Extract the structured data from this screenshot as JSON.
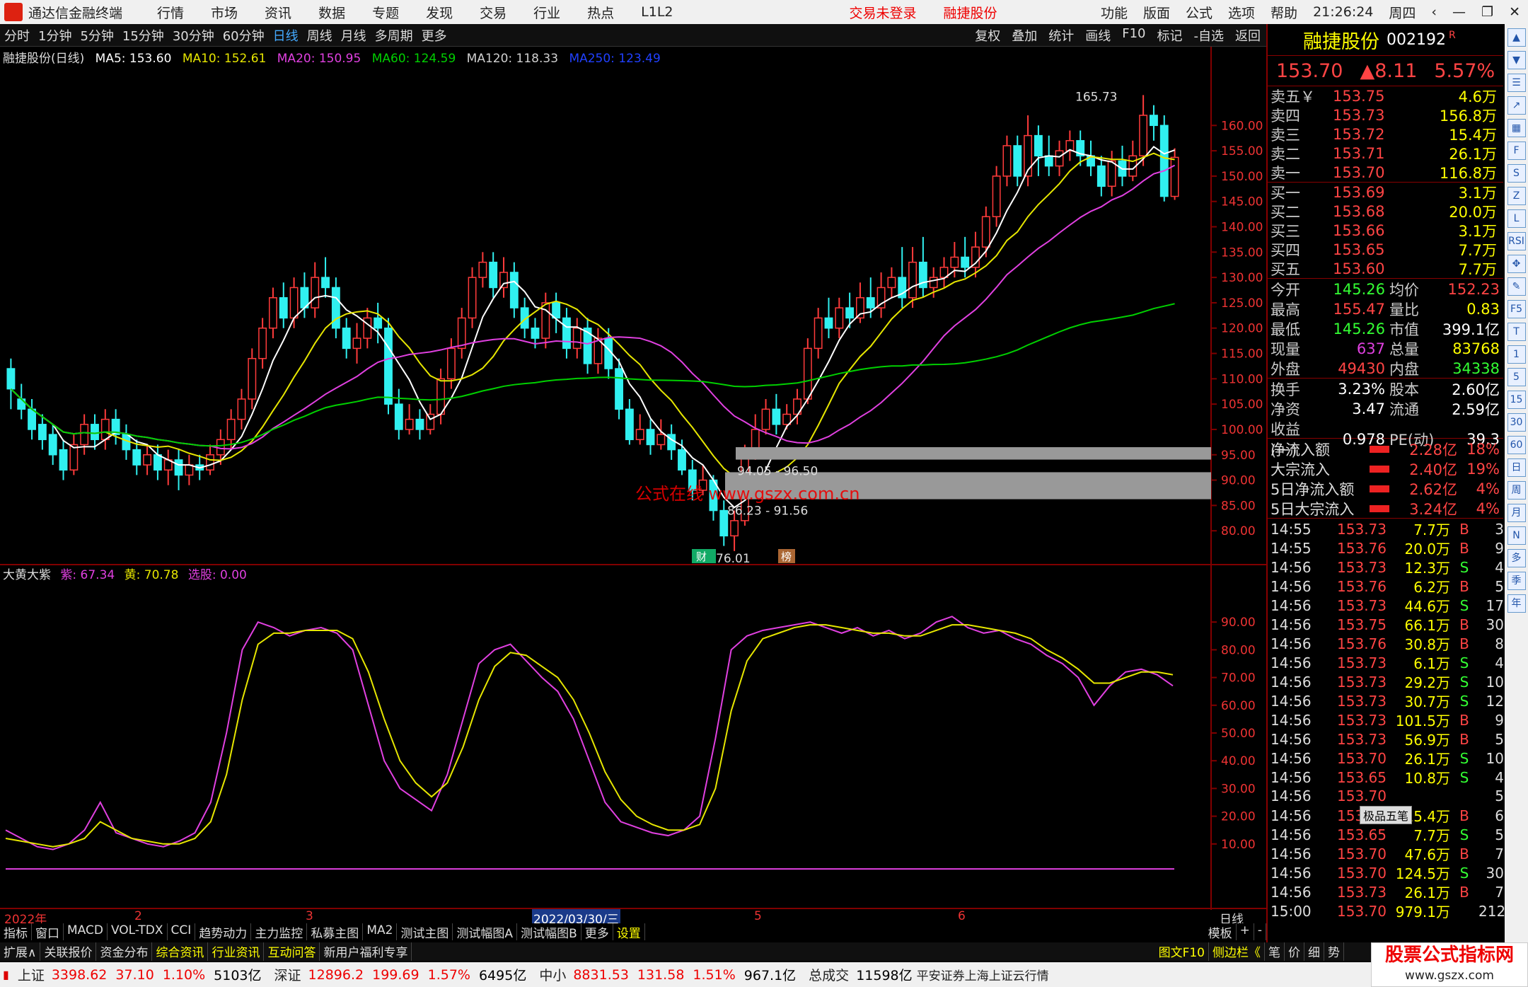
{
  "app": {
    "title": "通达信金融终端",
    "menu": [
      "行情",
      "市场",
      "资讯",
      "数据",
      "专题",
      "发现",
      "交易",
      "行业",
      "热点",
      "L1L2"
    ],
    "login_status": "交易未登录",
    "stock_title": "融捷股份",
    "right_menu": [
      "功能",
      "版面",
      "公式",
      "选项",
      "帮助"
    ],
    "time": "21:26:24",
    "weekday": "周四"
  },
  "periods": [
    "分时",
    "1分钟",
    "5分钟",
    "15分钟",
    "30分钟",
    "60分钟",
    "日线",
    "周线",
    "月线",
    "多周期",
    "更多"
  ],
  "active_period": "日线",
  "toolbar_right": [
    "复权",
    "叠加",
    "统计",
    "画线",
    "F10",
    "标记",
    "-自选",
    "返回"
  ],
  "legend": {
    "name": "融捷股份(日线)",
    "ma5": "MA5: 153.60",
    "ma10": "MA10: 152.61",
    "ma20": "MA20: 150.95",
    "ma60": "MA60: 124.59",
    "ma120": "MA120: 118.33",
    "ma250": "MA250: 123.49"
  },
  "colors": {
    "up": "#ff3b3b",
    "down": "#30f0f0",
    "ma5": "#ffffff",
    "ma10": "#e6e600",
    "ma20": "#e040e0",
    "ma60": "#00d000",
    "ma120": "#d0d0d0",
    "ma250": "#2040ff",
    "purple": "#e040e0",
    "yellow": "#e6e600",
    "grid": "#800000"
  },
  "indicator_legend": {
    "name": "大黄大紫",
    "purple": "紫: 67.34",
    "yellow": "黄: 70.78",
    "sel": "选股: 0.00"
  },
  "annotations": {
    "high": "165.73",
    "low": "76.01",
    "gap1": "94.05 - 96.50",
    "gap2": "86.23 - 91.56",
    "watermark": "公式在线 www.gszx.com.cn",
    "tag1": "财",
    "tag2": "榜"
  },
  "price_axis": [
    "160.00",
    "155.00",
    "150.00",
    "145.00",
    "140.00",
    "135.00",
    "130.00",
    "125.00",
    "120.00",
    "115.00",
    "110.00",
    "105.00",
    "100.00",
    "95.00",
    "90.00",
    "85.00",
    "80.00"
  ],
  "ind_axis": [
    "90.00",
    "80.00",
    "70.00",
    "60.00",
    "50.00",
    "40.00",
    "30.00",
    "20.00",
    "10.00"
  ],
  "dates": [
    {
      "t": "2022年"
    },
    {
      "t": "2"
    },
    {
      "t": "3"
    },
    {
      "t": "2022/03/30/三"
    },
    {
      "t": "5"
    },
    {
      "t": "6"
    },
    {
      "t": "日线"
    }
  ],
  "quote": {
    "name": "融捷股份",
    "code": "002192",
    "flag": "R",
    "price": "153.70",
    "change": "▲8.11",
    "pct": "5.57%",
    "asks": [
      {
        "l": "卖五￥",
        "p": "153.75",
        "v": "4.6万"
      },
      {
        "l": "卖四",
        "p": "153.73",
        "v": "156.8万"
      },
      {
        "l": "卖三",
        "p": "153.72",
        "v": "15.4万"
      },
      {
        "l": "卖二",
        "p": "153.71",
        "v": "26.1万"
      },
      {
        "l": "卖一",
        "p": "153.70",
        "v": "116.8万"
      }
    ],
    "bids": [
      {
        "l": "买一",
        "p": "153.69",
        "v": "3.1万"
      },
      {
        "l": "买二",
        "p": "153.68",
        "v": "20.0万"
      },
      {
        "l": "买三",
        "p": "153.66",
        "v": "3.1万"
      },
      {
        "l": "买四",
        "p": "153.65",
        "v": "7.7万"
      },
      {
        "l": "买五",
        "p": "153.60",
        "v": "7.7万"
      }
    ],
    "stats": [
      [
        "今开",
        "145.26",
        "均价",
        "152.23"
      ],
      [
        "最高",
        "155.47",
        "量比",
        "0.83"
      ],
      [
        "最低",
        "145.26",
        "市值",
        "399.1亿"
      ],
      [
        "现量",
        "637",
        "总量",
        "83768"
      ],
      [
        "外盘",
        "49430",
        "内盘",
        "34338"
      ]
    ],
    "stats2": [
      [
        "换手",
        "3.23%",
        "股本",
        "2.60亿"
      ],
      [
        "净资",
        "3.47",
        "流通",
        "2.59亿"
      ],
      [
        "收益(一)",
        "0.978",
        "PE(动)",
        "39.3"
      ]
    ],
    "flows": [
      [
        "净流入额",
        "2.28亿",
        "18%"
      ],
      [
        "大宗流入",
        "2.40亿",
        "19%"
      ],
      [
        "5日净流入额",
        "2.62亿",
        "4%"
      ],
      [
        "5日大宗流入",
        "3.24亿",
        "4%"
      ]
    ],
    "ticks": [
      [
        "14:55",
        "153.73",
        "7.7万",
        "B",
        "3"
      ],
      [
        "14:55",
        "153.76",
        "20.0万",
        "B",
        "9"
      ],
      [
        "14:56",
        "153.73",
        "12.3万",
        "S",
        "4"
      ],
      [
        "14:56",
        "153.76",
        "6.2万",
        "B",
        "5"
      ],
      [
        "14:56",
        "153.73",
        "44.6万",
        "S",
        "17"
      ],
      [
        "14:56",
        "153.75",
        "66.1万",
        "B",
        "30"
      ],
      [
        "14:56",
        "153.76",
        "30.8万",
        "B",
        "8"
      ],
      [
        "14:56",
        "153.73",
        "6.1万",
        "S",
        "4"
      ],
      [
        "14:56",
        "153.73",
        "29.2万",
        "S",
        "10"
      ],
      [
        "14:56",
        "153.73",
        "30.7万",
        "S",
        "12"
      ],
      [
        "14:56",
        "153.73",
        "101.5万",
        "B",
        "9"
      ],
      [
        "14:56",
        "153.73",
        "56.9万",
        "B",
        "5"
      ],
      [
        "14:56",
        "153.70",
        "26.1万",
        "S",
        "10"
      ],
      [
        "14:56",
        "153.65",
        "10.8万",
        "S",
        "4"
      ],
      [
        "14:56",
        "153.70",
        "",
        "",
        "5"
      ],
      [
        "14:56",
        "153.70",
        "15.4万",
        "B",
        "6"
      ],
      [
        "14:56",
        "153.65",
        "7.7万",
        "S",
        "5"
      ],
      [
        "14:56",
        "153.70",
        "47.6万",
        "B",
        "7"
      ],
      [
        "14:56",
        "153.70",
        "124.5万",
        "S",
        "30"
      ],
      [
        "14:56",
        "153.73",
        "26.1万",
        "B",
        "7"
      ],
      [
        "15:00",
        "153.70",
        "979.1万",
        "",
        "212"
      ]
    ],
    "ime": "极品五笔"
  },
  "side_icons": [
    "up-icon",
    "down-icon",
    "list-icon",
    "chart-icon",
    "grid-icon",
    "F",
    "S",
    "Z",
    "L",
    "RSI",
    "move-icon",
    "pen-icon",
    "F5",
    "T",
    "1",
    "5",
    "15",
    "30",
    "60",
    "日",
    "周",
    "月",
    "N",
    "多",
    "季",
    "年"
  ],
  "bottom_tabs": [
    "指标",
    "窗口",
    "MACD",
    "VOL-TDX",
    "CCI",
    "趋势动力",
    "主力监控",
    "私募主图",
    "MA2",
    "测试主图",
    "测试幅图A",
    "测试幅图B",
    "更多",
    "设置"
  ],
  "bottom_tabs_right": [
    "模板",
    "+",
    "-"
  ],
  "bottom_tabs2": [
    "扩展∧",
    "关联报价",
    "资金分布",
    "综合资讯",
    "行业资讯",
    "互动问答",
    "新用户福利专享"
  ],
  "bottom_tabs2_right": [
    "图文F10",
    "侧边栏《",
    "笔",
    "价",
    "细",
    "势"
  ],
  "status": {
    "sh_label": "上证",
    "sh_val": "3398.62",
    "sh_chg": "37.10",
    "sh_pct": "1.10%",
    "sh_amt": "5103亿",
    "sz_label": "深证",
    "sz_val": "12896.2",
    "sz_chg": "199.69",
    "sz_pct": "1.57%",
    "sz_amt": "6495亿",
    "zx_label": "中小",
    "zx_val": "8831.53",
    "zx_chg": "131.58",
    "zx_pct": "1.51%",
    "zx_amt": "967.1亿",
    "total_label": "总成交",
    "total_val": "11598亿",
    "src": "平安证券上海上证云行情",
    "brand": "股票公式指标网",
    "brand_url": "www.gszx.com"
  },
  "chart_data": [
    {
      "type": "candlestick",
      "title": "融捷股份(日线)",
      "ylim": [
        75,
        168
      ],
      "candles": [
        [
          112,
          108,
          114,
          104
        ],
        [
          106,
          104,
          109,
          102
        ],
        [
          104,
          100,
          106,
          98
        ],
        [
          101,
          98,
          103,
          96
        ],
        [
          99,
          95,
          101,
          93
        ],
        [
          96,
          92,
          98,
          90
        ],
        [
          92,
          97,
          99,
          91
        ],
        [
          97,
          101,
          103,
          95
        ],
        [
          101,
          98,
          103,
          96
        ],
        [
          98,
          102,
          104,
          96
        ],
        [
          102,
          99,
          104,
          97
        ],
        [
          99,
          96,
          101,
          94
        ],
        [
          96,
          93,
          98,
          91
        ],
        [
          93,
          95,
          97,
          91
        ],
        [
          95,
          92,
          97,
          90
        ],
        [
          92,
          94,
          96,
          89
        ],
        [
          94,
          91,
          96,
          88
        ],
        [
          91,
          93,
          95,
          89
        ],
        [
          93,
          92,
          95,
          90
        ],
        [
          92,
          95,
          97,
          91
        ],
        [
          95,
          98,
          100,
          93
        ],
        [
          98,
          102,
          104,
          96
        ],
        [
          102,
          106,
          108,
          100
        ],
        [
          106,
          114,
          116,
          104
        ],
        [
          114,
          120,
          122,
          112
        ],
        [
          120,
          126,
          128,
          118
        ],
        [
          126,
          122,
          129,
          120
        ],
        [
          122,
          128,
          130,
          120
        ],
        [
          128,
          124,
          131,
          122
        ],
        [
          124,
          130,
          133,
          122
        ],
        [
          130,
          128,
          134,
          126
        ],
        [
          128,
          120,
          130,
          118
        ],
        [
          120,
          116,
          122,
          114
        ],
        [
          116,
          118,
          121,
          113
        ],
        [
          118,
          122,
          124,
          116
        ],
        [
          122,
          120,
          125,
          117
        ],
        [
          120,
          105,
          122,
          103
        ],
        [
          105,
          100,
          108,
          98
        ],
        [
          100,
          102,
          105,
          99
        ],
        [
          102,
          100,
          104,
          98
        ],
        [
          100,
          103,
          105,
          99
        ],
        [
          103,
          110,
          112,
          101
        ],
        [
          110,
          116,
          118,
          108
        ],
        [
          116,
          122,
          124,
          114
        ],
        [
          122,
          130,
          132,
          120
        ],
        [
          130,
          133,
          135,
          128
        ],
        [
          133,
          128,
          135,
          126
        ],
        [
          128,
          131,
          134,
          126
        ],
        [
          131,
          124,
          133,
          122
        ],
        [
          124,
          120,
          126,
          118
        ],
        [
          120,
          118,
          122,
          116
        ],
        [
          118,
          125,
          127,
          116
        ],
        [
          125,
          122,
          127,
          119
        ],
        [
          122,
          116,
          124,
          114
        ],
        [
          116,
          120,
          122,
          114
        ],
        [
          120,
          113,
          122,
          111
        ],
        [
          113,
          118,
          120,
          111
        ],
        [
          118,
          112,
          120,
          110
        ],
        [
          112,
          104,
          114,
          102
        ],
        [
          104,
          98,
          106,
          97
        ],
        [
          98,
          100,
          103,
          97
        ],
        [
          100,
          97,
          102,
          95
        ],
        [
          97,
          99,
          102,
          96
        ],
        [
          99,
          96,
          101,
          94
        ],
        [
          96,
          92,
          98,
          91
        ],
        [
          92,
          88,
          94,
          86
        ],
        [
          88,
          90,
          93,
          87
        ],
        [
          90,
          84,
          91,
          82
        ],
        [
          84,
          79,
          86,
          77
        ],
        [
          79,
          82,
          84,
          76
        ],
        [
          82,
          95,
          97,
          81
        ],
        [
          95,
          100,
          103,
          94
        ],
        [
          100,
          104,
          106,
          99
        ],
        [
          104,
          101,
          107,
          99
        ],
        [
          101,
          103,
          105,
          100
        ],
        [
          103,
          106,
          108,
          101
        ],
        [
          106,
          116,
          118,
          105
        ],
        [
          116,
          122,
          124,
          114
        ],
        [
          122,
          120,
          126,
          118
        ],
        [
          120,
          124,
          126,
          118
        ],
        [
          124,
          122,
          127,
          120
        ],
        [
          122,
          126,
          129,
          121
        ],
        [
          126,
          124,
          130,
          122
        ],
        [
          124,
          128,
          131,
          122
        ],
        [
          128,
          130,
          132,
          126
        ],
        [
          130,
          126,
          136,
          124
        ],
        [
          126,
          133,
          136,
          124
        ],
        [
          133,
          128,
          138,
          126
        ],
        [
          128,
          130,
          132,
          126
        ],
        [
          130,
          132,
          134,
          128
        ],
        [
          132,
          134,
          137,
          130
        ],
        [
          134,
          132,
          138,
          130
        ],
        [
          132,
          136,
          139,
          130
        ],
        [
          136,
          142,
          144,
          134
        ],
        [
          142,
          150,
          152,
          140
        ],
        [
          150,
          156,
          158,
          148
        ],
        [
          156,
          150,
          158,
          148
        ],
        [
          150,
          158,
          162,
          148
        ],
        [
          158,
          154,
          160,
          150
        ],
        [
          154,
          152,
          158,
          150
        ],
        [
          152,
          155,
          157,
          150
        ],
        [
          155,
          157,
          159,
          153
        ],
        [
          157,
          154,
          159,
          152
        ],
        [
          154,
          152,
          157,
          150
        ],
        [
          152,
          148,
          154,
          146
        ],
        [
          148,
          153,
          155,
          146
        ],
        [
          153,
          150,
          156,
          148
        ],
        [
          150,
          154,
          157,
          149
        ],
        [
          154,
          162,
          166,
          152
        ],
        [
          162,
          160,
          164,
          157
        ],
        [
          160,
          146,
          162,
          145
        ],
        [
          146,
          153.7,
          155.5,
          145.3
        ]
      ]
    },
    {
      "type": "line",
      "title": "大黄大紫",
      "ylim": [
        0,
        100
      ],
      "series": [
        {
          "name": "紫",
          "values": [
            15,
            12,
            9,
            8,
            10,
            15,
            25,
            14,
            12,
            10,
            9,
            11,
            14,
            25,
            50,
            80,
            90,
            88,
            85,
            87,
            88,
            86,
            80,
            60,
            40,
            30,
            26,
            22,
            35,
            55,
            75,
            80,
            82,
            76,
            70,
            65,
            55,
            40,
            25,
            18,
            16,
            14,
            13,
            15,
            20,
            48,
            80,
            85,
            87,
            88,
            89,
            90,
            88,
            86,
            88,
            85,
            87,
            84,
            86,
            90,
            92,
            88,
            86,
            87,
            84,
            82,
            78,
            75,
            70,
            60,
            67,
            72,
            73,
            71,
            67
          ]
        },
        {
          "name": "黄",
          "values": [
            12,
            11,
            10,
            9,
            10,
            12,
            18,
            15,
            12,
            11,
            10,
            10,
            12,
            18,
            35,
            62,
            82,
            86,
            86,
            87,
            87,
            87,
            84,
            72,
            55,
            40,
            32,
            27,
            32,
            45,
            62,
            74,
            79,
            78,
            74,
            70,
            62,
            50,
            36,
            26,
            20,
            17,
            15,
            15,
            17,
            30,
            58,
            76,
            84,
            86,
            88,
            89,
            89,
            88,
            87,
            86,
            86,
            85,
            85,
            87,
            89,
            89,
            88,
            87,
            86,
            84,
            80,
            77,
            73,
            68,
            68,
            70,
            72,
            72,
            71
          ]
        }
      ]
    }
  ]
}
